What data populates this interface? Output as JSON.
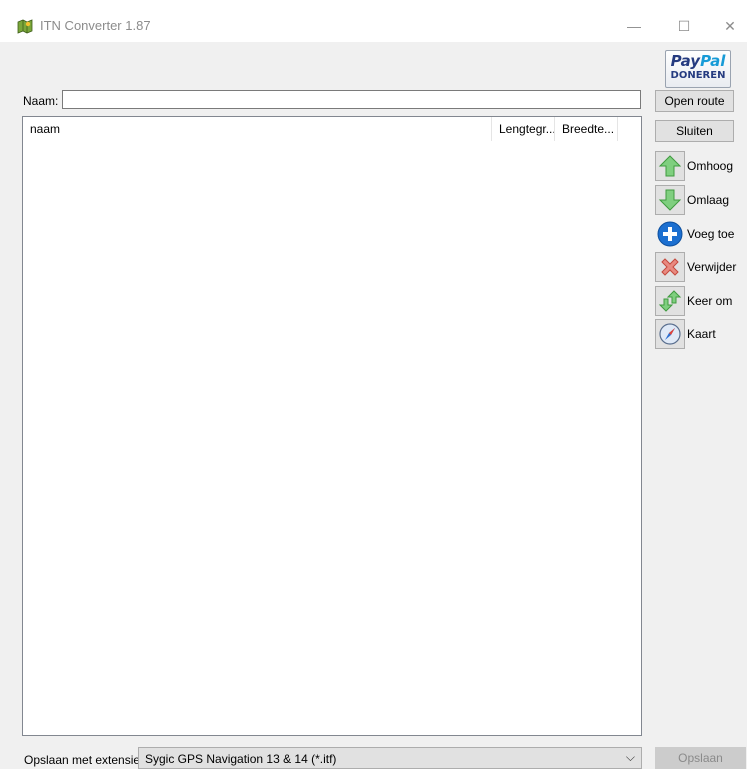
{
  "window": {
    "title": "ITN Converter 1.87",
    "minimize": "—",
    "maximize": "☐",
    "close": "✕"
  },
  "paypal": {
    "pay": "Pay",
    "pal": "Pal",
    "donate": "DONEREN",
    "icon": "paypal-logo"
  },
  "name_field": {
    "label": "Naam:",
    "value": ""
  },
  "buttons": {
    "open_route": "Open route",
    "close_route": "Sluiten",
    "save": "Opslaan"
  },
  "list": {
    "columns": [
      "naam",
      "Lengtegr...",
      "Breedte..."
    ],
    "rows": []
  },
  "tools": [
    {
      "label": "Omhoog",
      "icon": "arrow-up-icon"
    },
    {
      "label": "Omlaag",
      "icon": "arrow-down-icon"
    },
    {
      "label": "Voeg toe",
      "icon": "add-icon"
    },
    {
      "label": "Verwijder",
      "icon": "delete-icon"
    },
    {
      "label": "Keer om",
      "icon": "reverse-icon"
    },
    {
      "label": "Kaart",
      "icon": "compass-icon"
    }
  ],
  "extension": {
    "label": "Opslaan met extensie:",
    "selected": "Sygic GPS Navigation 13 & 14 (*.itf)"
  },
  "colors": {
    "green_arrow": "#6cc46c",
    "blue_add": "#1c6fd0",
    "red_delete": "#e2675c",
    "paypal_dark": "#253b80",
    "paypal_light": "#179bd7"
  }
}
